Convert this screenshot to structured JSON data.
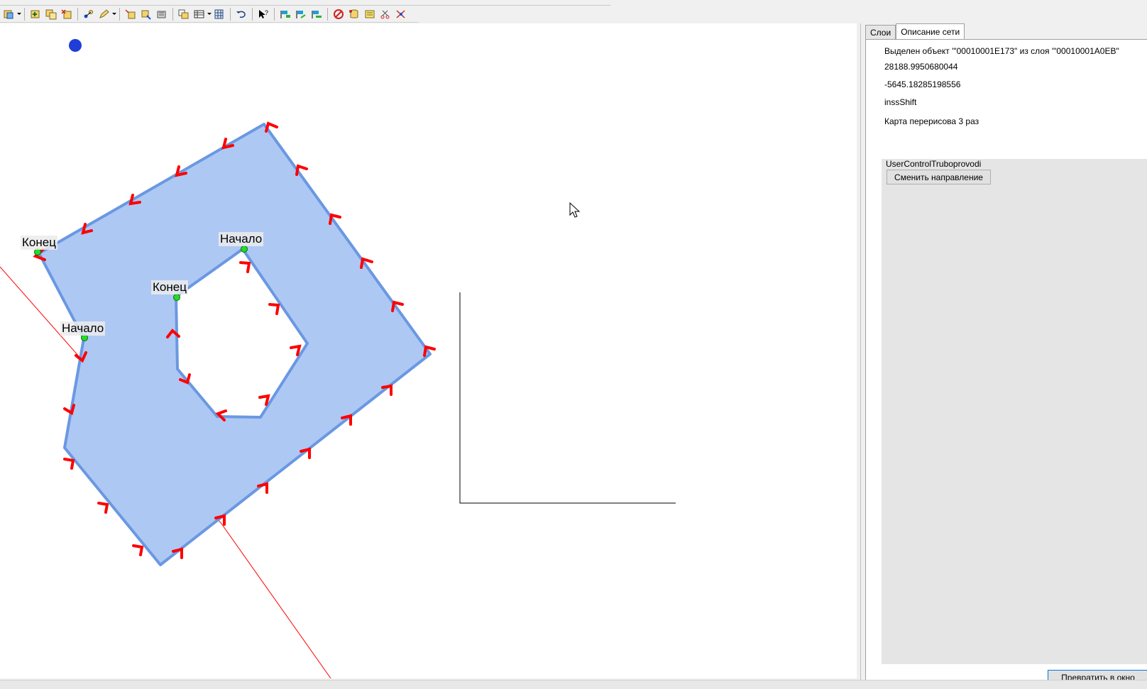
{
  "toolbar": {
    "buttons": [
      "layer-manage-icon",
      "layer-add-icon",
      "layer-copy-icon",
      "layer-remove-icon",
      "node-select-icon",
      "edit-pen-icon",
      "edit-vertex-icon",
      "edit-move-icon",
      "edit-tools-icon",
      "copy-object-icon",
      "table-icon",
      "grid-icon",
      "undo-icon",
      "help-pointer-icon",
      "flag-start-icon",
      "flag-end-icon",
      "flag-route-icon",
      "forbid-icon",
      "database-icon",
      "layer-yellow-icon",
      "scissors-icon",
      "network-delete-icon"
    ]
  },
  "map": {
    "labels": {
      "outer_end": "Конец",
      "inner_start": "Начало",
      "inner_end": "Конец",
      "outer_start": "Начало"
    },
    "colors": {
      "fill": "#aec8f4",
      "stroke": "#6a98e2",
      "arrow": "#ff0000",
      "node": "#22dd22",
      "point": "#1f3ed8"
    }
  },
  "panel": {
    "tabs": [
      "Слои",
      "Описание сети"
    ],
    "active_tab": "Описание сети",
    "info": {
      "selected": "Выделен объект '\"00010001E173\" из слоя '\"00010001A0EB\"",
      "x": "28188.9950680044",
      "y": "-5645.18285198556",
      "mode": "inssShift",
      "redraw": "Карта перерисова 3 раз"
    },
    "group_title": "UserControlTruboprovodi",
    "change_direction_label": "Сменить направление",
    "convert_label": "Превратить в окно"
  }
}
